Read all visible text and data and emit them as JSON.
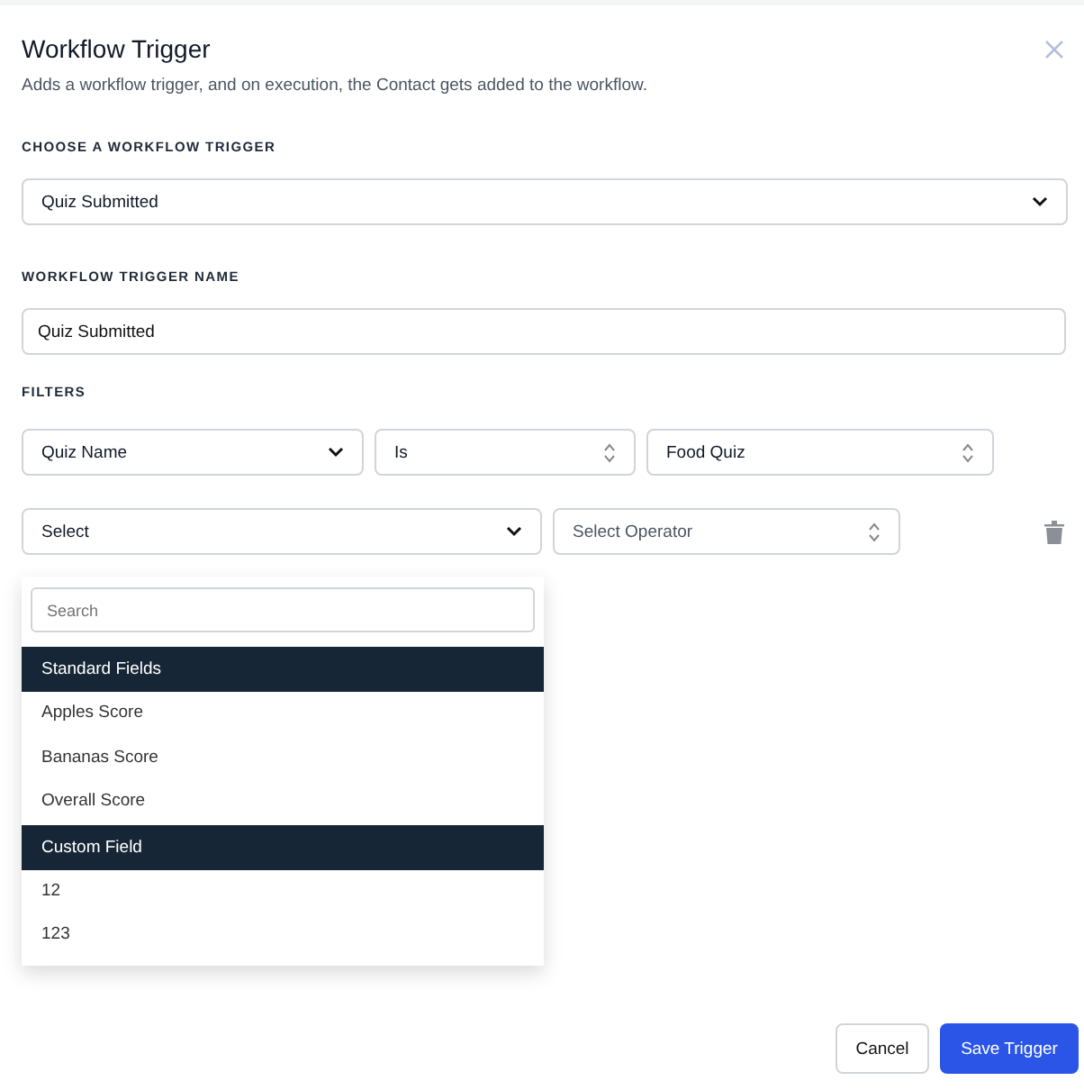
{
  "dialog": {
    "title": "Workflow Trigger",
    "subtitle": "Adds a workflow trigger, and on execution, the Contact gets added to the workflow."
  },
  "trigger": {
    "label": "CHOOSE A WORKFLOW TRIGGER",
    "value": "Quiz Submitted"
  },
  "trigger_name": {
    "label": "WORKFLOW TRIGGER NAME",
    "value": "Quiz Submitted"
  },
  "filters": {
    "label": "FILTERS",
    "rows": [
      {
        "fields": [
          {
            "kind": "chevron",
            "value": "Quiz Name",
            "placeholder_style": false
          },
          {
            "kind": "updown",
            "value": "Is",
            "placeholder_style": false
          },
          {
            "kind": "updown",
            "value": "Food Quiz",
            "placeholder_style": false
          }
        ],
        "deletable": false
      },
      {
        "fields": [
          {
            "kind": "chevron",
            "value": "Select",
            "placeholder_style": false
          },
          {
            "kind": "updown",
            "value": "Select Operator",
            "placeholder_style": true
          }
        ],
        "deletable": true
      }
    ]
  },
  "dropdown": {
    "search_placeholder": "Search",
    "items": [
      {
        "kind": "header",
        "label": "Standard Fields"
      },
      {
        "kind": "option",
        "label": "Apples Score"
      },
      {
        "kind": "option",
        "label": "Bananas Score"
      },
      {
        "kind": "option",
        "label": "Overall Score"
      },
      {
        "kind": "header",
        "label": "Custom Field"
      },
      {
        "kind": "option",
        "label": "12"
      },
      {
        "kind": "option",
        "label": "123"
      }
    ]
  },
  "buttons": [
    {
      "kind": "secondary",
      "label": "Cancel"
    },
    {
      "kind": "primary",
      "label": "Save Trigger"
    }
  ]
}
